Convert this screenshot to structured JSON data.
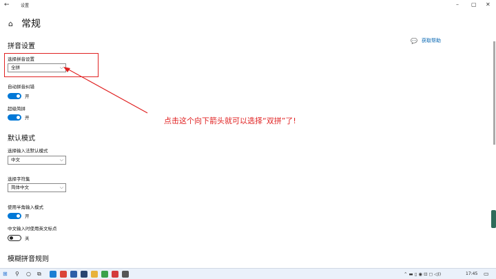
{
  "window": {
    "title": "设置",
    "back": "←",
    "minimize": "–",
    "maximize": "▢",
    "close": "✕"
  },
  "page": {
    "title": "常规",
    "help_link": "获取帮助"
  },
  "pinyin_section": {
    "title": "拼音设置",
    "select_label": "选择拼音设置",
    "select_value": "全拼",
    "auto_correct_label": "自动拼音纠错",
    "auto_correct_state": "开",
    "super_jianpin_label": "超级简拼",
    "super_jianpin_state": "开"
  },
  "default_section": {
    "title": "默认模式",
    "input_mode_label": "选择输入法默认模式",
    "input_mode_value": "中文",
    "charset_label": "选择字符集",
    "charset_value": "简体中文",
    "halfwidth_label": "使用半角输入模式",
    "halfwidth_state": "开",
    "en_punct_label": "中文输入时使用英文标点",
    "en_punct_state": "关"
  },
  "fuzzy_section": {
    "title": "模糊拼音规则"
  },
  "annotation": {
    "text": "点击这个向下箭头就可以选择“双拼”了!",
    "color": "#e02020"
  },
  "taskbar": {
    "clock": "17:45",
    "tray": "⌃ ▬ ▯ ◉ ⊡ ◻ ◁))",
    "apps": [
      {
        "name": "windows-start-icon",
        "color": "#1f6fd0"
      },
      {
        "name": "edge-icon",
        "color": "#1a7fd4"
      },
      {
        "name": "chrome-icon",
        "color": "#db4437"
      },
      {
        "name": "app-icon-blue",
        "color": "#2d5fa8"
      },
      {
        "name": "app-icon-navy",
        "color": "#29446f"
      },
      {
        "name": "file-explorer-icon",
        "color": "#e8b23a"
      },
      {
        "name": "app-icon-green",
        "color": "#3aa14a"
      },
      {
        "name": "wps-icon",
        "color": "#d43b3b"
      },
      {
        "name": "settings-icon",
        "color": "#555555"
      }
    ]
  }
}
